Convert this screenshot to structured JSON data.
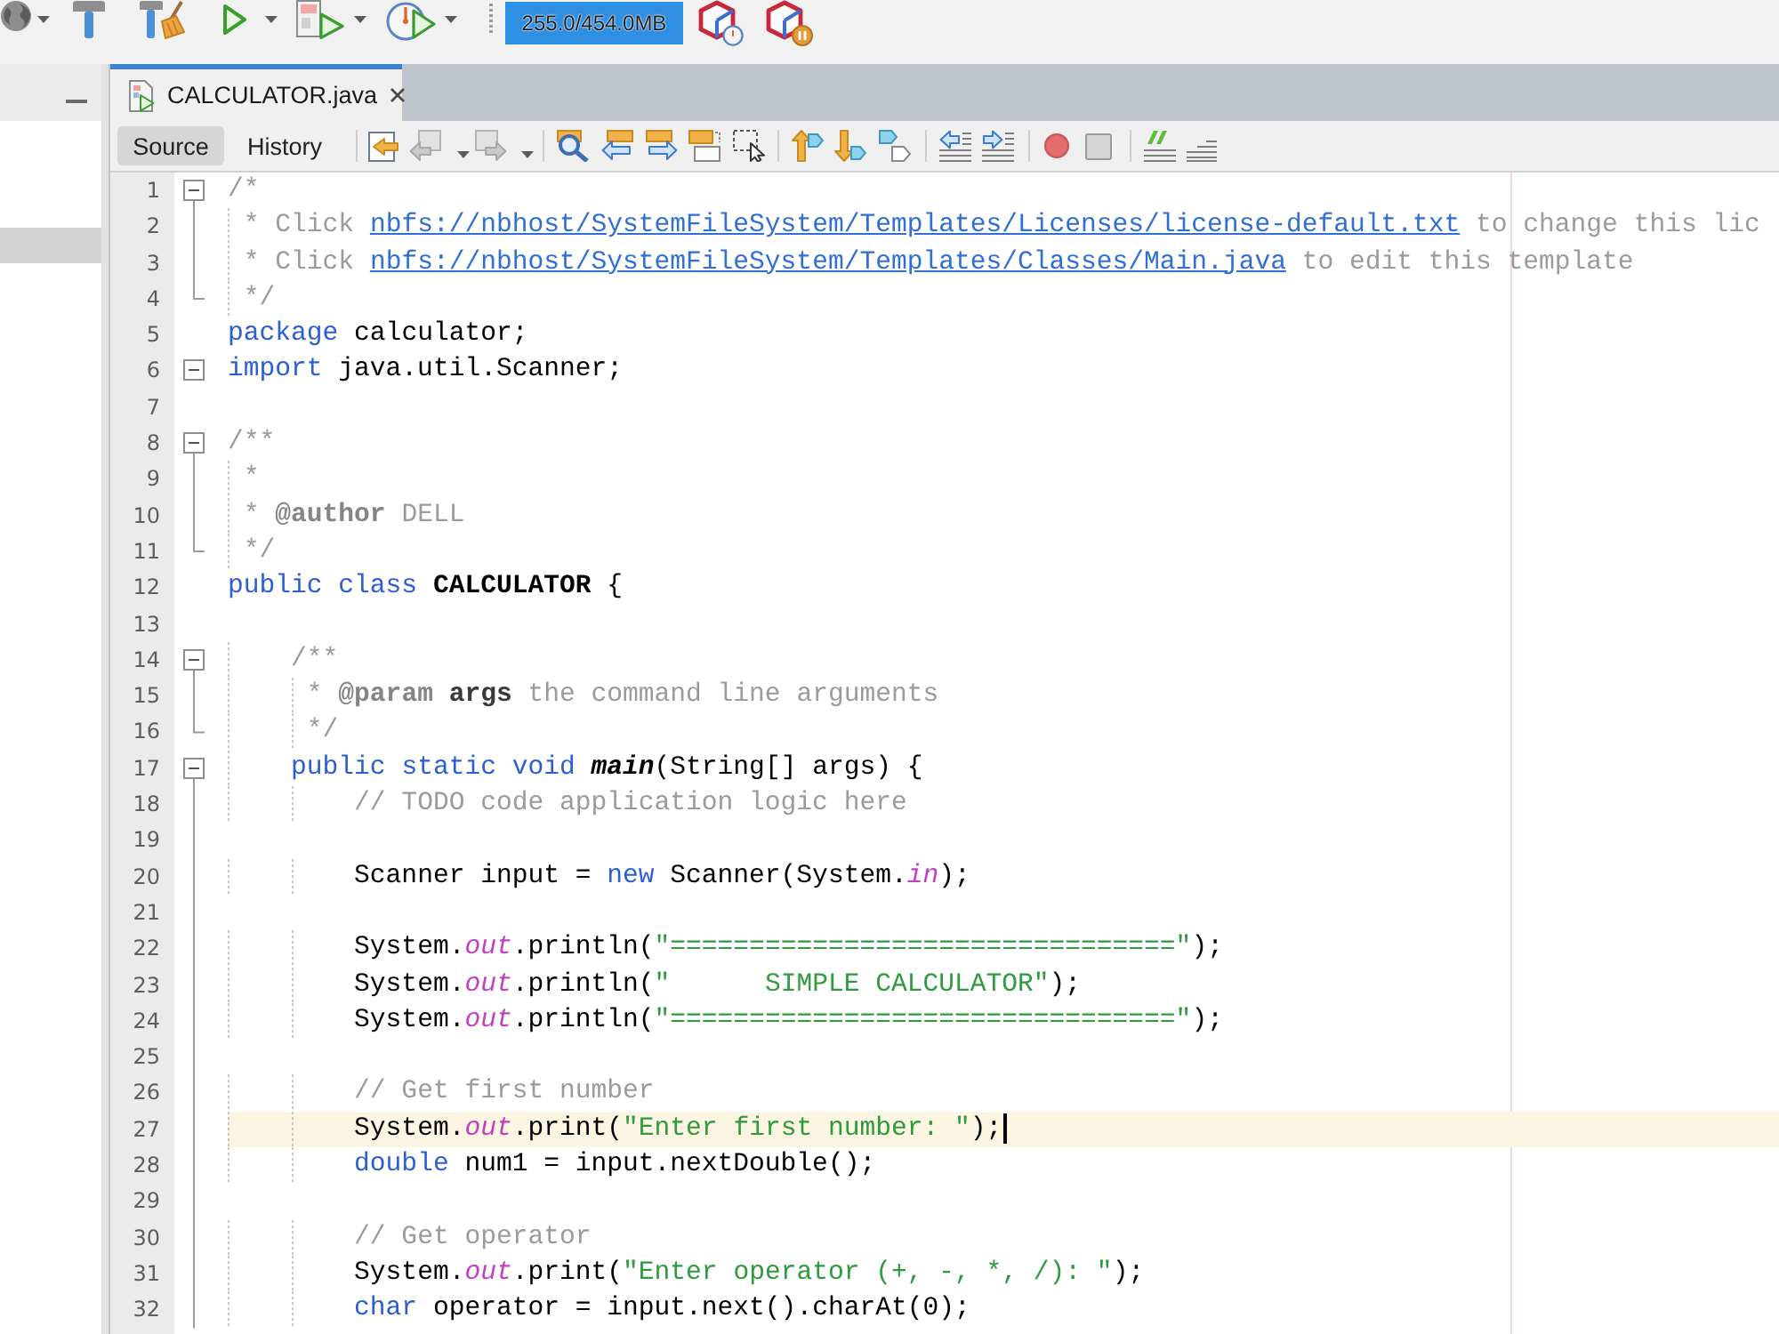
{
  "toolbar": {
    "memory": {
      "text": "255.0/454.0MB"
    }
  },
  "side_panel": {
    "rows": [
      {
        "selected": true
      }
    ]
  },
  "editor": {
    "tabs": [
      {
        "label": "CALCULATOR.java",
        "selected": true
      }
    ],
    "view_tabs": [
      {
        "label": "Source",
        "selected": true
      },
      {
        "label": "History",
        "selected": false
      }
    ],
    "navigation": [
      {
        "disabled": true
      },
      {
        "disabled": true
      }
    ],
    "lines": [
      {
        "number": "1",
        "kind": "start",
        "current": false,
        "spans": [
          {
            "kind": "comment",
            "text": "/*"
          }
        ]
      },
      {
        "number": "2",
        "kind": "body",
        "current": false,
        "spans": [
          {
            "kind": "comment",
            "text": " * Click "
          },
          {
            "kind": "link",
            "text": "nbfs://nbhost/SystemFileSystem/Templates/Licenses/license-default.txt"
          },
          {
            "kind": "comment",
            "text": " to change this lic"
          }
        ]
      },
      {
        "number": "3",
        "kind": "body",
        "current": false,
        "spans": [
          {
            "kind": "comment",
            "text": " * Click "
          },
          {
            "kind": "link",
            "text": "nbfs://nbhost/SystemFileSystem/Templates/Classes/Main.java"
          },
          {
            "kind": "comment",
            "text": " to edit this template"
          }
        ]
      },
      {
        "number": "4",
        "kind": "end",
        "current": false,
        "spans": [
          {
            "kind": "comment",
            "text": " */"
          }
        ]
      },
      {
        "number": "5",
        "kind": "plain",
        "current": false,
        "spans": [
          {
            "kind": "keyword",
            "text": "package"
          },
          {
            "kind": "plain",
            "text": " calculator;"
          }
        ]
      },
      {
        "number": "6",
        "kind": "single",
        "current": false,
        "spans": [
          {
            "kind": "keyword",
            "text": "import"
          },
          {
            "kind": "plain",
            "text": " java.util.Scanner;"
          }
        ]
      },
      {
        "number": "7",
        "kind": "plain",
        "current": false
      },
      {
        "number": "8",
        "kind": "start",
        "current": false,
        "spans": [
          {
            "kind": "comment",
            "text": "/**"
          }
        ]
      },
      {
        "number": "9",
        "kind": "body",
        "current": false,
        "spans": [
          {
            "kind": "comment",
            "text": " *"
          }
        ]
      },
      {
        "number": "10",
        "kind": "body",
        "current": false,
        "spans": [
          {
            "kind": "comment",
            "text": " * "
          },
          {
            "kind": "doctag",
            "text": "@author"
          },
          {
            "kind": "comment",
            "text": " DELL"
          }
        ]
      },
      {
        "number": "11",
        "kind": "end",
        "current": false,
        "spans": [
          {
            "kind": "comment",
            "text": " */"
          }
        ]
      },
      {
        "number": "12",
        "kind": "plain",
        "current": false,
        "spans": [
          {
            "kind": "keyword",
            "text": "public class "
          },
          {
            "kind": "bold",
            "text": "CALCULATOR"
          },
          {
            "kind": "plain",
            "text": " {"
          }
        ]
      },
      {
        "number": "13",
        "kind": "plain",
        "current": false
      },
      {
        "number": "14",
        "kind": "start",
        "current": false,
        "spans": [
          {
            "kind": "comment",
            "text": "    /**"
          }
        ]
      },
      {
        "number": "15",
        "kind": "body",
        "current": false,
        "spans": [
          {
            "kind": "comment",
            "text": "     * "
          },
          {
            "kind": "doctag",
            "text": "@param"
          },
          {
            "kind": "docparam",
            "text": " args"
          },
          {
            "kind": "comment",
            "text": " the command line arguments"
          }
        ]
      },
      {
        "number": "16",
        "kind": "end",
        "current": false,
        "spans": [
          {
            "kind": "comment",
            "text": "     */"
          }
        ]
      },
      {
        "number": "17",
        "kind": "start",
        "current": false,
        "spans": [
          {
            "kind": "keyword",
            "text": "    public static void "
          },
          {
            "kind": "bolditalic",
            "text": "main"
          },
          {
            "kind": "plain",
            "text": "(String[] args) {"
          }
        ]
      },
      {
        "number": "18",
        "kind": "body",
        "current": false,
        "spans": [
          {
            "kind": "comment",
            "text": "        // TODO code application logic here"
          }
        ]
      },
      {
        "number": "19",
        "kind": "body",
        "current": false
      },
      {
        "number": "20",
        "kind": "body",
        "current": false,
        "spans": [
          {
            "kind": "plain",
            "text": "        Scanner input = "
          },
          {
            "kind": "keyword",
            "text": "new"
          },
          {
            "kind": "plain",
            "text": " Scanner(System."
          },
          {
            "kind": "field",
            "text": "in"
          },
          {
            "kind": "plain",
            "text": ");"
          }
        ]
      },
      {
        "number": "21",
        "kind": "body",
        "current": false
      },
      {
        "number": "22",
        "kind": "body",
        "current": false,
        "spans": [
          {
            "kind": "plain",
            "text": "        System."
          },
          {
            "kind": "field",
            "text": "out"
          },
          {
            "kind": "plain",
            "text": ".println("
          },
          {
            "kind": "string",
            "text": "\"================================\""
          },
          {
            "kind": "plain",
            "text": ");"
          }
        ]
      },
      {
        "number": "23",
        "kind": "body",
        "current": false,
        "spans": [
          {
            "kind": "plain",
            "text": "        System."
          },
          {
            "kind": "field",
            "text": "out"
          },
          {
            "kind": "plain",
            "text": ".println("
          },
          {
            "kind": "string",
            "text": "\"      SIMPLE CALCULATOR\""
          },
          {
            "kind": "plain",
            "text": ");"
          }
        ]
      },
      {
        "number": "24",
        "kind": "body",
        "current": false,
        "spans": [
          {
            "kind": "plain",
            "text": "        System."
          },
          {
            "kind": "field",
            "text": "out"
          },
          {
            "kind": "plain",
            "text": ".println("
          },
          {
            "kind": "string",
            "text": "\"================================\""
          },
          {
            "kind": "plain",
            "text": ");"
          }
        ]
      },
      {
        "number": "25",
        "kind": "body",
        "current": false
      },
      {
        "number": "26",
        "kind": "body",
        "current": false,
        "spans": [
          {
            "kind": "comment",
            "text": "        // Get first number"
          }
        ]
      },
      {
        "number": "27",
        "kind": "body",
        "current": true,
        "spans": [
          {
            "kind": "plain",
            "text": "        System."
          },
          {
            "kind": "field",
            "text": "out"
          },
          {
            "kind": "plain",
            "text": ".print("
          },
          {
            "kind": "string",
            "text": "\"Enter first number: \""
          },
          {
            "kind": "plain",
            "text": ");"
          }
        ]
      },
      {
        "number": "28",
        "kind": "body",
        "current": false,
        "spans": [
          {
            "kind": "keyword",
            "text": "        double"
          },
          {
            "kind": "plain",
            "text": " num1 = input.nextDouble();"
          }
        ]
      },
      {
        "number": "29",
        "kind": "body",
        "current": false
      },
      {
        "number": "30",
        "kind": "body",
        "current": false,
        "spans": [
          {
            "kind": "comment",
            "text": "        // Get operator"
          }
        ]
      },
      {
        "number": "31",
        "kind": "body",
        "current": false,
        "spans": [
          {
            "kind": "plain",
            "text": "        System."
          },
          {
            "kind": "field",
            "text": "out"
          },
          {
            "kind": "plain",
            "text": ".print("
          },
          {
            "kind": "string",
            "text": "\"Enter operator (+, -, *, /): \""
          },
          {
            "kind": "plain",
            "text": ");"
          }
        ]
      },
      {
        "number": "32",
        "kind": "body",
        "current": false,
        "spans": [
          {
            "kind": "keyword",
            "text": "        char"
          },
          {
            "kind": "plain",
            "text": " operator = input.next().charAt(0);"
          }
        ]
      }
    ]
  }
}
